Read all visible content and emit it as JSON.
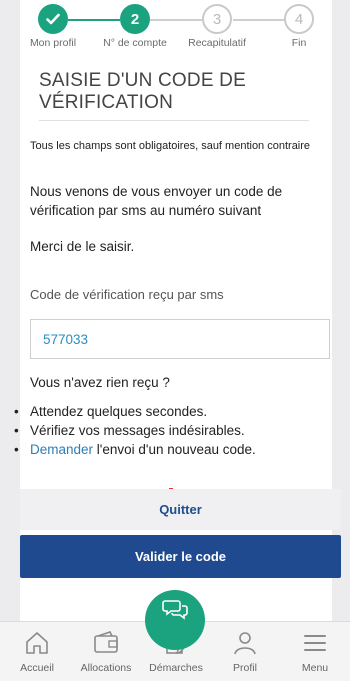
{
  "stepper": {
    "steps": [
      {
        "number": "✓",
        "label": "Mon profil"
      },
      {
        "number": "2",
        "label": "N° de compte"
      },
      {
        "number": "3",
        "label": "Recapitulatif"
      },
      {
        "number": "4",
        "label": "Fin"
      }
    ]
  },
  "page": {
    "title": "SAISIE D'UN CODE DE VÉRIFICATION",
    "required_note": "Tous les champs sont obligatoires, sauf mention contraire",
    "intro": "Nous venons de vous envoyer un code de vérification par sms au numéro suivant",
    "please_enter": "Merci de le saisir."
  },
  "code_field": {
    "label": "Code de vérification reçu par sms",
    "value": "577033"
  },
  "help": {
    "question": "Vous n'avez rien reçu ?",
    "tip1": "Attendez quelques secondes.",
    "tip2": "Vérifiez vos messages indésirables.",
    "tip3_link": "Demander",
    "tip3_rest": " l'envoi d'un nouveau code."
  },
  "buttons": {
    "quit": "Quitter",
    "validate": "Valider le code"
  },
  "navbar": {
    "items": [
      {
        "label": "Accueil",
        "icon": "home-icon"
      },
      {
        "label": "Allocations",
        "icon": "wallet-icon"
      },
      {
        "label": "Démarches",
        "icon": "document-edit-icon"
      },
      {
        "label": "Profil",
        "icon": "user-icon"
      },
      {
        "label": "Menu",
        "icon": "hamburger-icon"
      }
    ]
  },
  "colors": {
    "accent_green": "#1ba37f",
    "primary_blue": "#1f4a8f",
    "link_blue": "#2a7fb5"
  }
}
